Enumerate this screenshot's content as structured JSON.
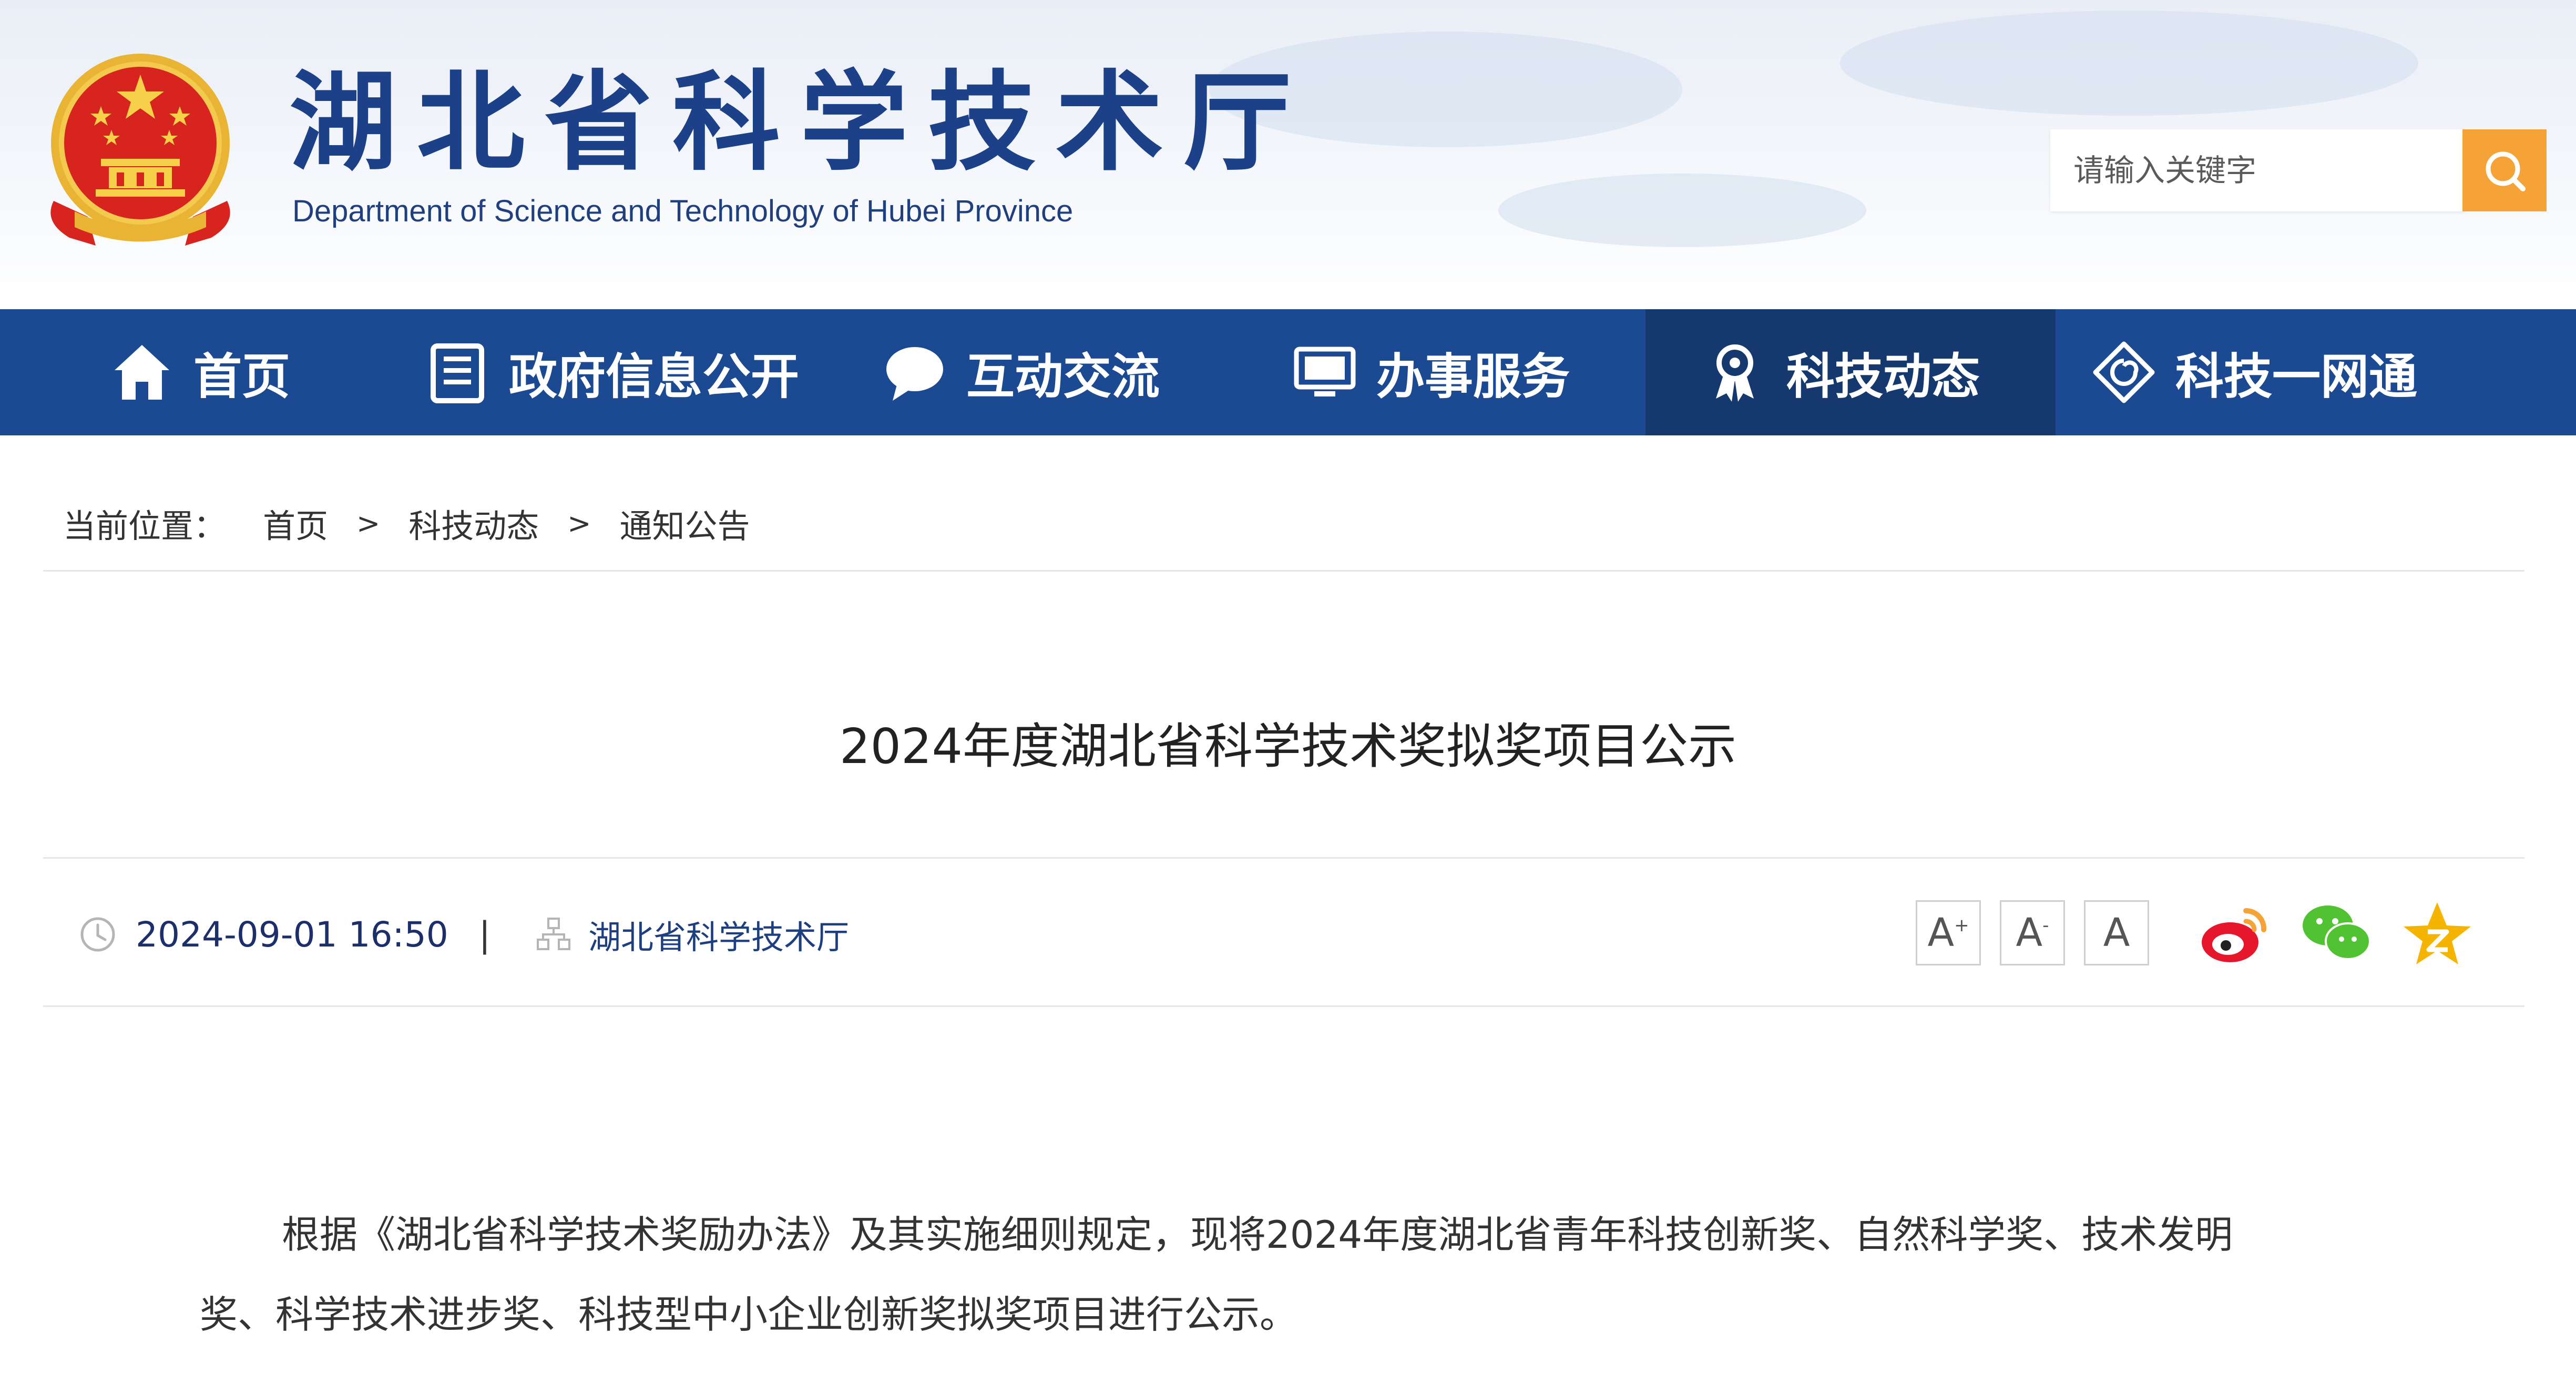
{
  "header": {
    "site_title": "湖北省科学技术厅",
    "site_subtitle": "Department of Science and Technology of Hubei Province",
    "emblem_icon": "national-emblem-icon",
    "search": {
      "placeholder": "请输入关键字",
      "button_icon": "search-icon"
    }
  },
  "nav": {
    "items": [
      {
        "label": "首页",
        "icon": "home-icon"
      },
      {
        "label": "政府信息公开",
        "icon": "document-icon"
      },
      {
        "label": "互动交流",
        "icon": "chat-bubble-icon"
      },
      {
        "label": "办事服务",
        "icon": "monitor-icon"
      },
      {
        "label": "科技动态",
        "icon": "award-ribbon-icon",
        "active": true
      },
      {
        "label": "科技一网通",
        "icon": "swirl-icon"
      }
    ]
  },
  "breadcrumb": {
    "prefix": "当前位置：",
    "items": [
      "首页",
      "科技动态",
      "通知公告"
    ],
    "separator": ">"
  },
  "article": {
    "title": "2024年度湖北省科学技术奖拟奖项目公示",
    "date": "2024-09-01 16:50",
    "pipe": "|",
    "source": "湖北省科学技术厅",
    "font_sizes": [
      {
        "label": "A",
        "mod": "+"
      },
      {
        "label": "A",
        "mod": "-"
      },
      {
        "label": "A",
        "mod": ""
      }
    ],
    "share": [
      "weibo-icon",
      "wechat-icon",
      "qzone-icon"
    ],
    "body_line1": "根据《湖北省科学技术奖励办法》及其实施细则规定，现将2024年度湖北省青年科技创新奖、自然科学奖、技术发明",
    "body_line2": "奖、科学技术进步奖、科技型中小企业创新奖拟奖项目进行公示。"
  },
  "colors": {
    "nav_bg": "#1b4a93",
    "nav_active_bg": "#15396f",
    "title_blue": "#1d4189",
    "search_button": "#f5a336",
    "weibo": "#e6162d",
    "wechat": "#51c332",
    "qzone": "#f5b400"
  }
}
